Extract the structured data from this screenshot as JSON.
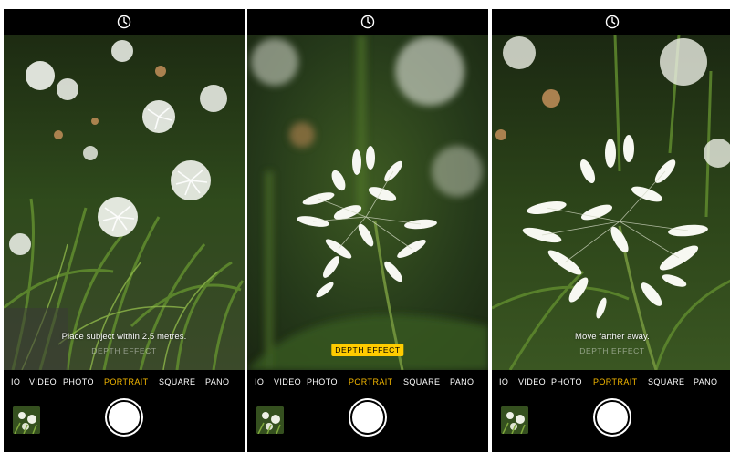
{
  "screens": [
    {
      "hint": "Place subject within 2.5 metres.",
      "depth_label": "DEPTH EFFECT",
      "depth_active": false,
      "modes": [
        "IO",
        "VIDEO",
        "PHOTO",
        "PORTRAIT",
        "SQUARE",
        "PANO"
      ],
      "active_mode": "PORTRAIT"
    },
    {
      "hint": "",
      "depth_label": "DEPTH EFFECT",
      "depth_active": true,
      "modes": [
        "IO",
        "VIDEO",
        "PHOTO",
        "PORTRAIT",
        "SQUARE",
        "PANO"
      ],
      "active_mode": "PORTRAIT"
    },
    {
      "hint": "Move farther away.",
      "depth_label": "DEPTH EFFECT",
      "depth_active": false,
      "modes": [
        "IO",
        "VIDEO",
        "PHOTO",
        "PORTRAIT",
        "SQUARE",
        "PANO"
      ],
      "active_mode": "PORTRAIT"
    }
  ],
  "icons": {
    "timer": "timer-icon",
    "shutter": "shutter-button",
    "thumbnail": "photo-thumbnail"
  },
  "colors": {
    "accent_mode": "#f5b800",
    "depth_badge": "#ffcc00",
    "bar": "#000000"
  }
}
